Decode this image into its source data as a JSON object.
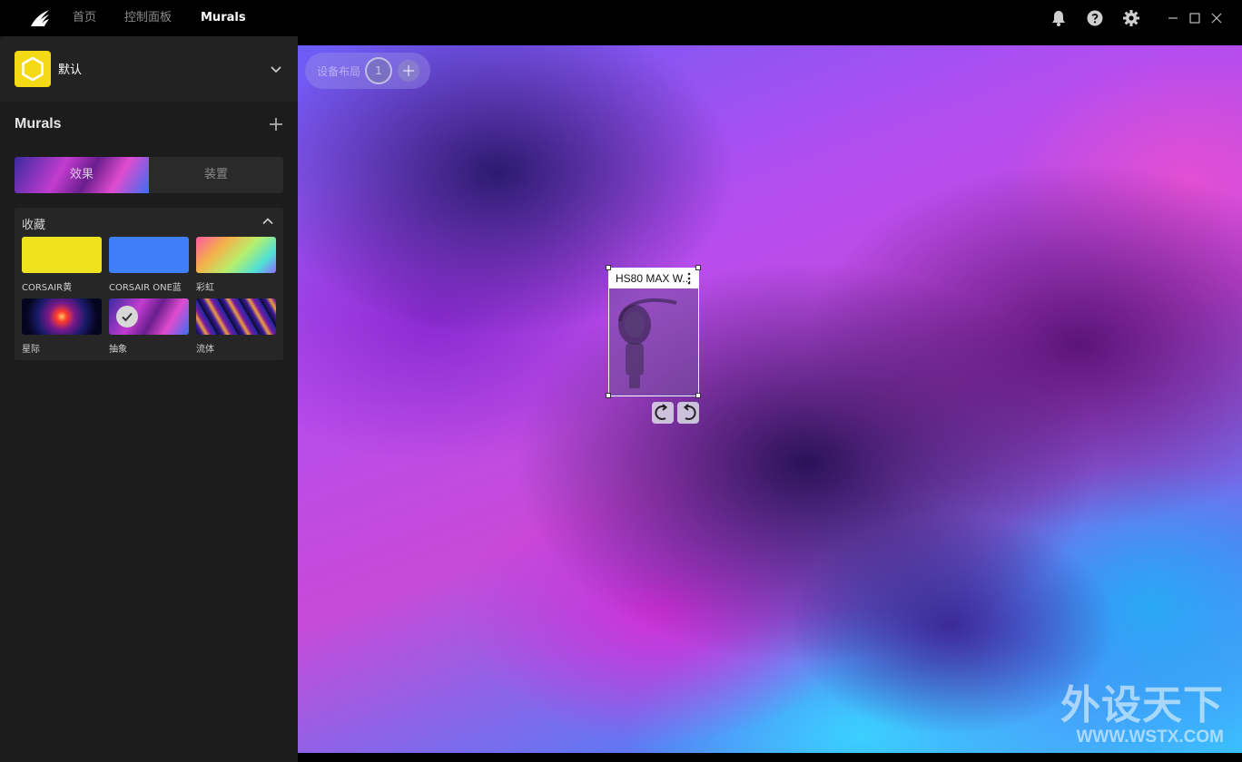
{
  "nav": {
    "home": "首页",
    "dashboard": "控制面板",
    "murals": "Murals"
  },
  "topbar_icons": [
    "bell-icon",
    "help-icon",
    "gear-icon"
  ],
  "window_controls": [
    "minimize-icon",
    "maximize-icon",
    "close-icon"
  ],
  "profile": {
    "name": "默认",
    "icon_color": "#f4d914"
  },
  "murals": {
    "title": "Murals",
    "tabs": [
      {
        "label": "效果",
        "active": true
      },
      {
        "label": "装置",
        "active": false
      }
    ]
  },
  "favorites": {
    "title": "收藏",
    "items": [
      {
        "label": "CORSAIR黄",
        "swatch": "solid-yellow",
        "color": "#efe21f",
        "selected": false
      },
      {
        "label": "CORSAIR ONE蓝",
        "swatch": "solid-blue",
        "color": "#3f7ef6",
        "selected": false
      },
      {
        "label": "彩虹",
        "swatch": "rainbow-gradient",
        "selected": false
      },
      {
        "label": "星际",
        "swatch": "stellar-image",
        "selected": false
      },
      {
        "label": "抽象",
        "swatch": "abstract-image",
        "selected": true
      },
      {
        "label": "流体",
        "swatch": "fluid-image",
        "selected": false
      }
    ]
  },
  "canvas": {
    "layout_label": "设备布局",
    "layout_number": "1",
    "device_name": "HS80 MAX W..."
  },
  "watermark": {
    "title": "外设天下",
    "url": "WWW.WSTX.COM"
  }
}
